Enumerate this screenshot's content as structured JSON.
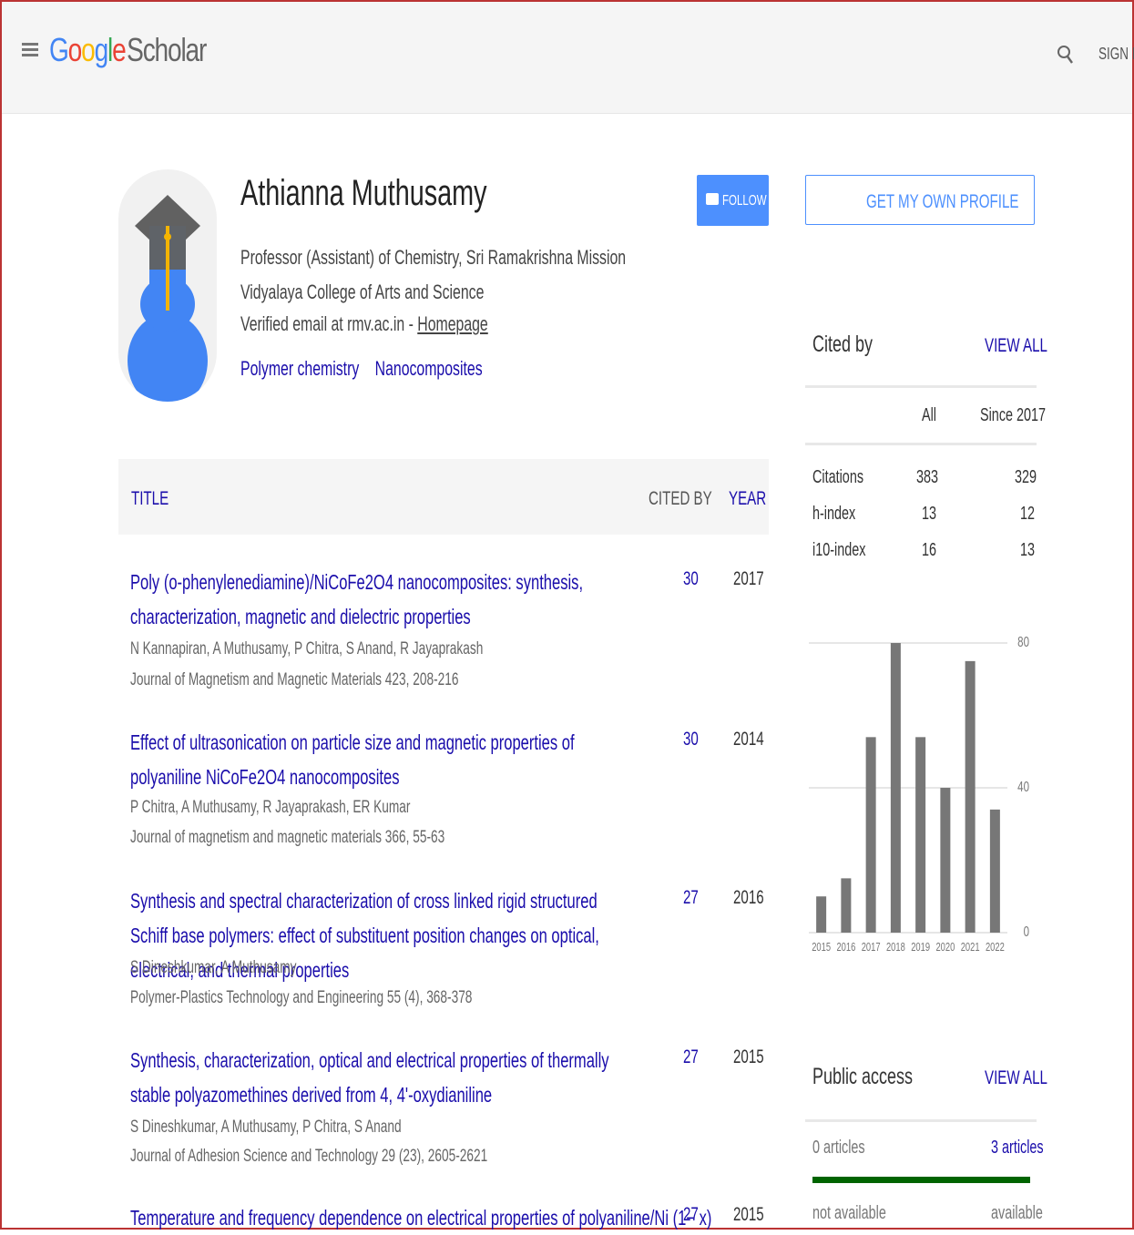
{
  "header": {
    "logo_google": [
      "G",
      "o",
      "o",
      "g",
      "l",
      "e"
    ],
    "logo_scholar": "Scholar",
    "signin_label": "SIGN IN"
  },
  "profile": {
    "name": "Athianna Muthusamy",
    "affiliation": "Professor (Assistant) of Chemistry, Sri Ramakrishna Mission Vidyalaya College of Arts and Science",
    "email_text": "Verified email at rmv.ac.in - ",
    "homepage_label": "Homepage",
    "interests": [
      "Polymer chemistry",
      "Nanocomposites"
    ],
    "follow_label": "FOLLOW"
  },
  "table": {
    "headers": {
      "title": "TITLE",
      "cited_by": "CITED BY",
      "year": "YEAR"
    },
    "rows": [
      {
        "title": "Poly (o-phenylenediamine)/NiCoFe2O4 nanocomposites: synthesis, characterization, magnetic and dielectric properties",
        "authors": "N Kannapiran, A Muthusamy, P Chitra, S Anand, R Jayaprakash",
        "journal": "Journal of Magnetism and Magnetic Materials 423, 208-216",
        "cited": "30",
        "year": "2017"
      },
      {
        "title": "Effect of ultrasonication on particle size and magnetic properties of polyaniline NiCoFe2O4 nanocomposites",
        "authors": "P Chitra, A Muthusamy, R Jayaprakash, ER Kumar",
        "journal": "Journal of magnetism and magnetic materials 366, 55-63",
        "cited": "30",
        "year": "2014"
      },
      {
        "title": "Synthesis and spectral characterization of cross linked rigid structured Schiff base polymers: effect of substituent position changes on optical, electrical, and thermal properties",
        "authors": "S Dineshkumar, A Muthusamy",
        "journal": "Polymer-Plastics Technology and Engineering 55 (4), 368-378",
        "cited": "27",
        "year": "2016"
      },
      {
        "title": "Synthesis, characterization, optical and electrical properties of thermally stable polyazomethines derived from 4, 4'-oxydianiline",
        "authors": "S Dineshkumar, A Muthusamy, P Chitra, S Anand",
        "journal": "Journal of Adhesion Science and Technology 29 (23), 2605-2621",
        "cited": "27",
        "year": "2015"
      },
      {
        "title": "Temperature and frequency dependence on electrical properties of polyaniline/Ni (1− x)",
        "authors": "",
        "journal": "",
        "cited": "27",
        "year": "2015"
      }
    ]
  },
  "sidebar": {
    "get_profile_label": "GET MY OWN PROFILE",
    "cited_by": {
      "heading": "Cited by",
      "view_all": "VIEW ALL",
      "col_all": "All",
      "col_since": "Since 2017",
      "rows": [
        {
          "label": "Citations",
          "all": "383",
          "since": "329"
        },
        {
          "label": "h-index",
          "all": "13",
          "since": "12"
        },
        {
          "label": "i10-index",
          "all": "16",
          "since": "13"
        }
      ]
    },
    "public_access": {
      "heading": "Public access",
      "view_all": "VIEW ALL",
      "left_count": "0 articles",
      "right_count": "3 articles",
      "left_status": "not available",
      "right_status": "available",
      "available_fraction": 1.0
    }
  },
  "chart_data": {
    "type": "bar",
    "categories": [
      "2015",
      "2016",
      "2017",
      "2018",
      "2019",
      "2020",
      "2021",
      "2022"
    ],
    "values": [
      10,
      15,
      54,
      80,
      54,
      40,
      75,
      34
    ],
    "ylim": [
      0,
      80
    ],
    "yticks": [
      "80",
      "40",
      "0"
    ],
    "bar_color": "#777777",
    "grid": true
  },
  "colors": {
    "link": "#1a0dab",
    "accent": "#4d90fe",
    "available_bar": "#006400"
  }
}
